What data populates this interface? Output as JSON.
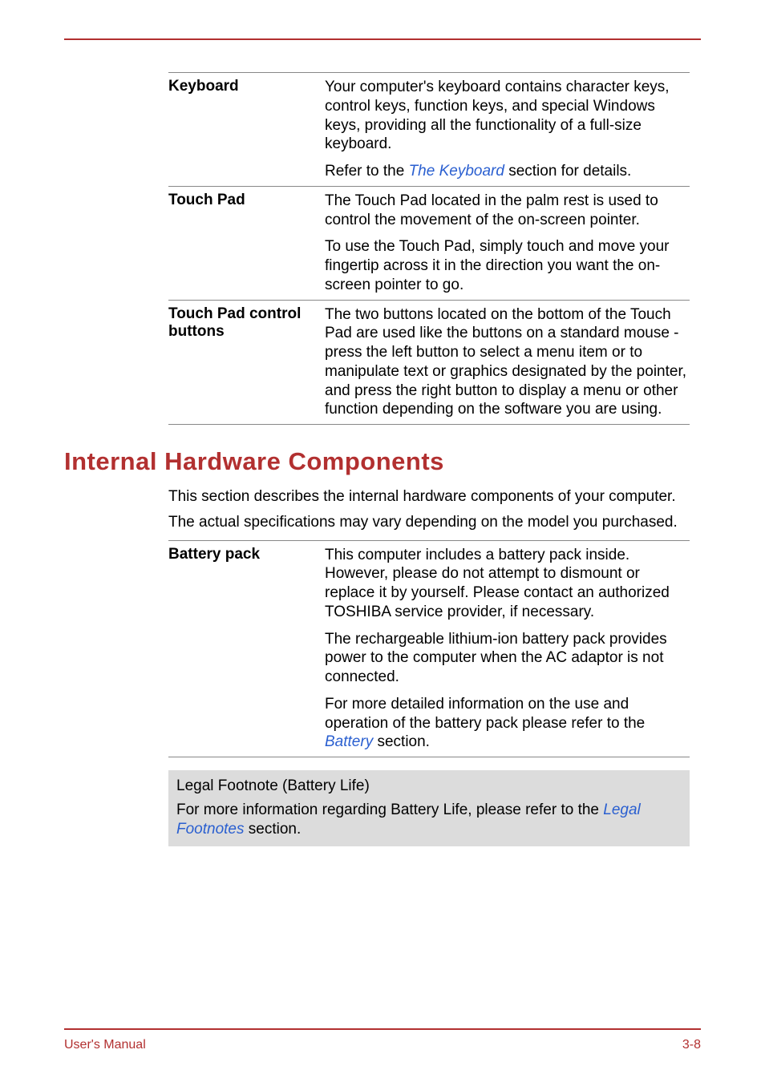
{
  "table1": {
    "rows": [
      {
        "label": "Keyboard",
        "paras": [
          {
            "pre": "Your computer's keyboard contains character keys, control keys, function keys, and special Windows keys, providing all the functionality of a full-size keyboard."
          },
          {
            "pre": "Refer to the ",
            "link": "The Keyboard",
            "post": " section for details."
          }
        ]
      },
      {
        "label": "Touch Pad",
        "paras": [
          {
            "pre": "The Touch Pad located in the palm rest is used to control the movement of the on-screen pointer."
          },
          {
            "pre": "To use the Touch Pad, simply touch and move your fingertip across it in the direction you want the on-screen pointer to go."
          }
        ]
      },
      {
        "label": "Touch Pad control buttons",
        "paras": [
          {
            "pre": "The two buttons located on the bottom of the Touch Pad are used like the buttons on a standard mouse - press the left button to select a menu item or to manipulate text or graphics designated by the pointer, and press the right button to display a menu or other function depending on the software you are using."
          }
        ]
      }
    ]
  },
  "section_heading": "Internal Hardware Components",
  "intro1": "This section describes the internal hardware components of your computer.",
  "intro2": "The actual specifications may vary depending on the model you purchased.",
  "table2": {
    "rows": [
      {
        "label": "Battery pack",
        "paras": [
          {
            "pre": "This computer includes a battery pack inside. However, please do not attempt to dismount or replace it by yourself. Please contact an authorized TOSHIBA service provider, if necessary."
          },
          {
            "pre": "The rechargeable lithium-ion battery pack provides power to the computer when the AC adaptor is not connected."
          },
          {
            "pre": "For more detailed information on the use and operation of the battery pack please refer to the ",
            "link": "Battery",
            "post": " section."
          }
        ]
      }
    ]
  },
  "note": {
    "title": "Legal Footnote (Battery Life)",
    "para": {
      "pre": "For more information regarding Battery Life, please refer to the ",
      "link": "Legal Footnotes",
      "post": " section."
    }
  },
  "footer_left": "User's Manual",
  "footer_right": "3-8"
}
